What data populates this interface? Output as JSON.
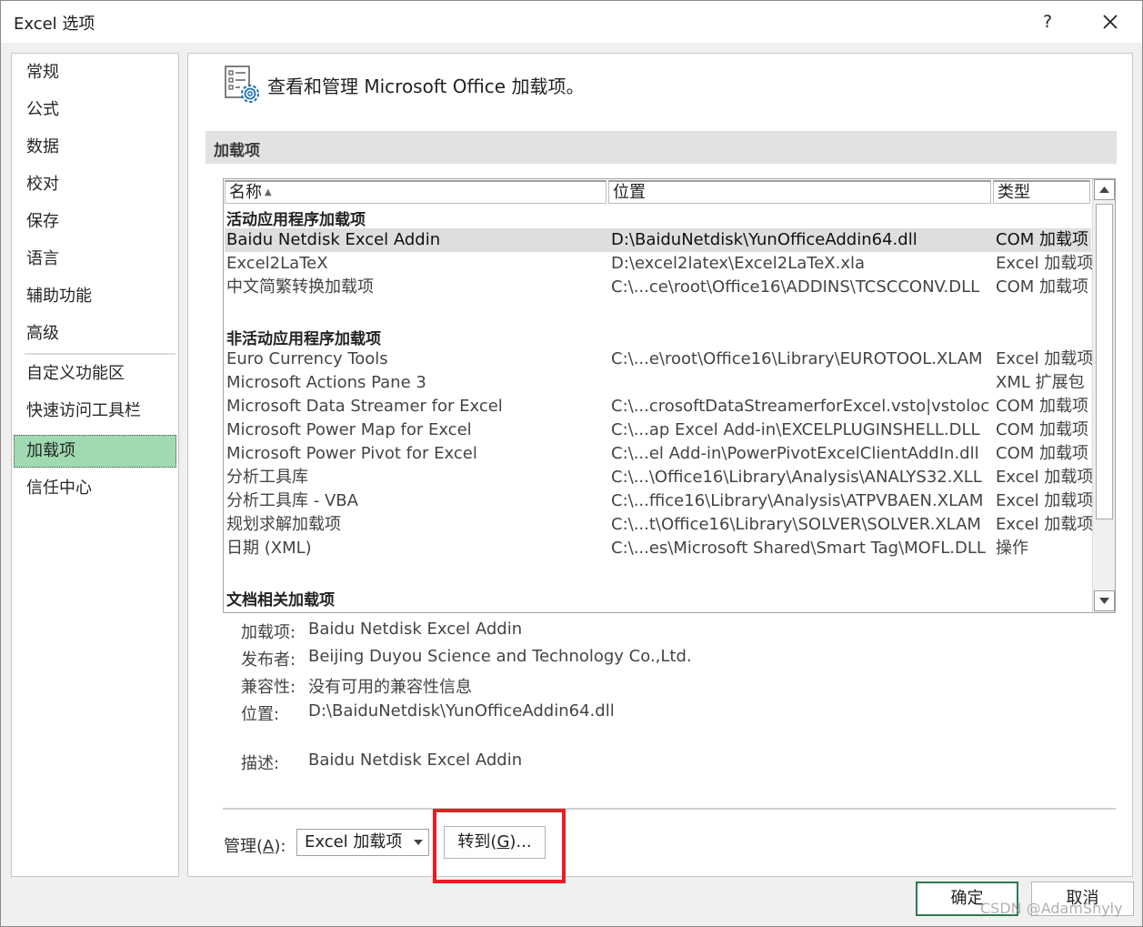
{
  "window": {
    "title": "Excel 选项",
    "help_label": "?"
  },
  "sidebar": {
    "items": [
      {
        "label": "常规"
      },
      {
        "label": "公式"
      },
      {
        "label": "数据"
      },
      {
        "label": "校对"
      },
      {
        "label": "保存"
      },
      {
        "label": "语言"
      },
      {
        "label": "辅助功能"
      },
      {
        "label": "高级"
      },
      {
        "label": "自定义功能区"
      },
      {
        "label": "快速访问工具栏"
      },
      {
        "label": "加载项"
      },
      {
        "label": "信任中心"
      }
    ],
    "active": "加载项"
  },
  "header": {
    "text": "查看和管理 Microsoft Office 加载项。",
    "icon": "addins-gear-icon"
  },
  "section": {
    "title": "加载项"
  },
  "table": {
    "columns": {
      "name": "名称",
      "location": "位置",
      "type": "类型"
    },
    "sort_icon": "▲",
    "groups": [
      {
        "title": "活动应用程序加载项",
        "rows": [
          {
            "name": "Baidu Netdisk Excel Addin",
            "location": "D:\\BaiduNetdisk\\YunOfficeAddin64.dll",
            "type": "COM 加载项"
          },
          {
            "name": "Excel2LaTeX",
            "location": "D:\\excel2latex\\Excel2LaTeX.xla",
            "type": "Excel 加载项"
          },
          {
            "name": "中文简繁转换加载项",
            "location": "C:\\...ce\\root\\Office16\\ADDINS\\TCSCCONV.DLL",
            "type": "COM 加载项"
          }
        ]
      },
      {
        "title": "非活动应用程序加载项",
        "rows": [
          {
            "name": "Euro Currency Tools",
            "location": "C:\\...e\\root\\Office16\\Library\\EUROTOOL.XLAM",
            "type": "Excel 加载项"
          },
          {
            "name": "Microsoft Actions Pane 3",
            "location": "",
            "type": "XML 扩展包"
          },
          {
            "name": "Microsoft Data Streamer for Excel",
            "location": "C:\\...crosoftDataStreamerforExcel.vsto|vstolocal",
            "type": "COM 加载项"
          },
          {
            "name": "Microsoft Power Map for Excel",
            "location": "C:\\...ap Excel Add-in\\EXCELPLUGINSHELL.DLL",
            "type": "COM 加载项"
          },
          {
            "name": "Microsoft Power Pivot for Excel",
            "location": "C:\\...el Add-in\\PowerPivotExcelClientAddIn.dll",
            "type": "COM 加载项"
          },
          {
            "name": "分析工具库",
            "location": "C:\\...\\Office16\\Library\\Analysis\\ANALYS32.XLL",
            "type": "Excel 加载项"
          },
          {
            "name": "分析工具库 - VBA",
            "location": "C:\\...ffice16\\Library\\Analysis\\ATPVBAEN.XLAM",
            "type": "Excel 加载项"
          },
          {
            "name": "规划求解加载项",
            "location": "C:\\...t\\Office16\\Library\\SOLVER\\SOLVER.XLAM",
            "type": "Excel 加载项"
          },
          {
            "name": "日期 (XML)",
            "location": "C:\\...es\\Microsoft Shared\\Smart Tag\\MOFL.DLL",
            "type": "操作"
          }
        ]
      },
      {
        "title": "文档相关加载项",
        "rows": []
      }
    ],
    "selected_row": "Baidu Netdisk Excel Addin"
  },
  "details": {
    "addin_label": "加载项:",
    "addin_value": "Baidu Netdisk Excel Addin",
    "publisher_label": "发布者:",
    "publisher_value": "Beijing Duyou Science and Technology Co.,Ltd.",
    "compat_label": "兼容性:",
    "compat_value": "没有可用的兼容性信息",
    "location_label": "位置:",
    "location_value": "D:\\BaiduNetdisk\\YunOfficeAddin64.dll",
    "desc_label": "描述:",
    "desc_value": "Baidu Netdisk Excel Addin"
  },
  "manage": {
    "label_prefix": "管理(",
    "label_key": "A",
    "label_suffix": "):",
    "selected": "Excel 加载项",
    "go_prefix": "转到(",
    "go_key": "G",
    "go_suffix": ")..."
  },
  "footer": {
    "ok_label": "确定",
    "cancel_label": "取消"
  },
  "watermark": "CSDN @AdamShyly",
  "colors": {
    "selected_nav": "#a0dab2",
    "highlight": "#ec1c24",
    "ok_border": "#2e7a4f"
  }
}
